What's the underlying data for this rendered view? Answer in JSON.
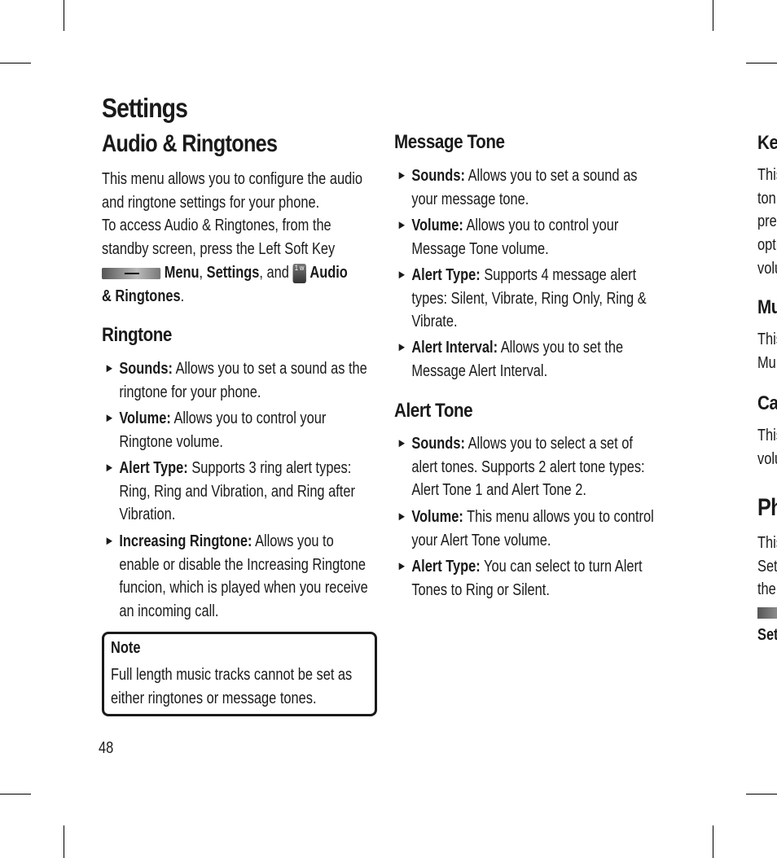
{
  "page_title": "Settings",
  "page_number": "48",
  "audio": {
    "title": "Audio & Ringtones",
    "intro_lines": [
      "This menu allows you to configure the audio",
      "and ringtone settings for your phone.",
      "To access Audio & Ringtones, from the",
      "standby screen, press the Left Soft Key"
    ],
    "path_menu": "Menu",
    "path_sep1": ",",
    "path_settings": "Settings",
    "path_sep2": ", and",
    "path_audio": "Audio",
    "path_ringtones": "& Ringtones",
    "path_end": ".",
    "key_w_glyph": "1 w"
  },
  "ringtone": {
    "title": "Ringtone",
    "items": [
      {
        "label": "Sounds:",
        "lines": [
          "Allows you to set a sound as the",
          "ringtone for your phone."
        ]
      },
      {
        "label": "Volume:",
        "lines": [
          "Allows you to control your",
          "Ringtone volume."
        ]
      },
      {
        "label": "Alert Type:",
        "lines": [
          "Supports 3 ring alert types:",
          "Ring, Ring and Vibration, and Ring after",
          "Vibration."
        ]
      },
      {
        "label": "Increasing Ringtone:",
        "lines": [
          "Allows you to",
          "enable or disable the Increasing Ringtone",
          "funcion, which is played when you receive",
          "an incoming call."
        ]
      }
    ]
  },
  "note": {
    "title": "Note",
    "lines": [
      "Full length music tracks cannot be set as",
      "either ringtones or message tones."
    ]
  },
  "message_tone": {
    "title": "Message Tone",
    "items": [
      {
        "label": "Sounds:",
        "lines": [
          "Allows you to set a sound as",
          "your message tone."
        ]
      },
      {
        "label": "Volume:",
        "lines": [
          "Allows you to control your",
          "Message Tone volume."
        ]
      },
      {
        "label": "Alert Type:",
        "lines": [
          "Supports 4 message alert",
          "types: Silent, Vibrate, Ring Only, Ring &",
          "Vibrate."
        ]
      },
      {
        "label": "Alert Interval:",
        "lines": [
          "Allows you to set the",
          "Message Alert Interval."
        ]
      }
    ]
  },
  "alert_tone": {
    "title": "Alert Tone",
    "items": [
      {
        "label": "Sounds:",
        "lines": [
          "Allows you to select a set of",
          "alert tones. Supports 2 alert tone types:",
          "Alert Tone 1 and Alert Tone 2."
        ]
      },
      {
        "label": "Volume:",
        "lines": [
          "This menu allows you to control",
          "your Alert Tone volume."
        ]
      },
      {
        "label": "Alert Type:",
        "lines": [
          "You can select to turn Alert",
          "Tones to Ring or Silent."
        ]
      }
    ]
  },
  "right_cut": {
    "h1": "Ke",
    "p1": [
      "This",
      "ton",
      "pre",
      "opt",
      "volu"
    ],
    "h2": "Mu",
    "p2": [
      "This",
      "Mu"
    ],
    "h3": "Ca",
    "p3": [
      "This",
      "volu"
    ],
    "h4": "Ph",
    "p4": [
      "This",
      "Set",
      "the"
    ],
    "last": "Set"
  },
  "bullet_glyph": "►"
}
